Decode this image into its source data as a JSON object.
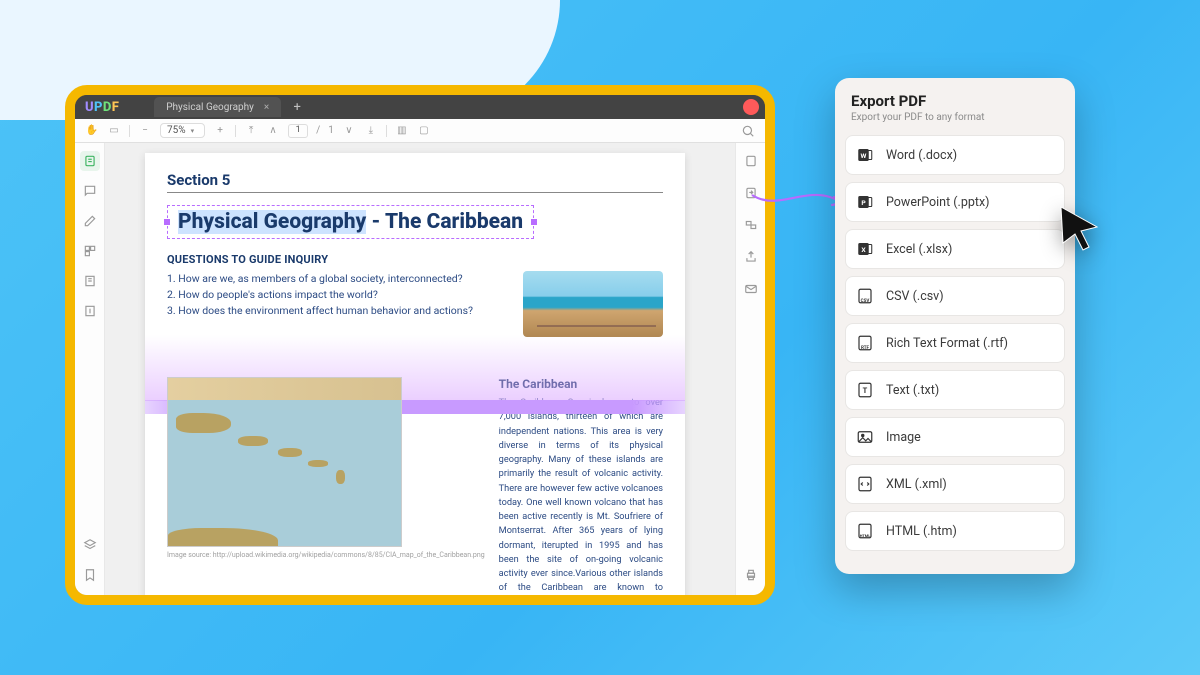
{
  "app": {
    "logo": "UPDF"
  },
  "tab": {
    "title": "Physical Geography"
  },
  "toolbar": {
    "zoom": "75%",
    "page_current": "1",
    "page_total": "1"
  },
  "doc": {
    "section_label": "Section 5",
    "title_highlight": "Physical Geography",
    "title_sep": " - ",
    "title_rest": "The Caribbean",
    "inquiry_header": "QUESTIONS TO GUIDE INQUIRY",
    "q1": "1. How are we, as members of a global society, interconnected?",
    "q2": "2. How do people's actions impact the world?",
    "q3": "3. How does the environment affect human behavior and actions?",
    "body_header": "The Caribbean",
    "body_text": "The Caribbean Sea is home to over 7,000 islands, thirteen of which are independent nations. This area is very diverse in terms of its physical geography. Many of these islands are primarily the result of volcanic activity. There are however few active volcanoes today. One well known volcano that has been active recently is Mt. Soufriere of Montserrat. After 365 years of lying dormant, iterupted in 1995 and has been the site of on-going volcanic activity ever since.Various other islands of the Caribbean are known to experience various forms of volcanic activity, even the island of Trinidad has small volcanoes. Most of the non-volcanic island found in this area are coral islands that formed from the coral reefs found throughout the Caribbean.",
    "map_caption": "Image source: http://upload.wikimedia.org/wikipedia/commons/8/85/CIA_map_of_the_Caribbean.png"
  },
  "export": {
    "title": "Export PDF",
    "subtitle": "Export your PDF to any format",
    "formats": {
      "word": "Word (.docx)",
      "ppt": "PowerPoint (.pptx)",
      "excel": "Excel (.xlsx)",
      "csv": "CSV (.csv)",
      "rtf": "Rich Text Format (.rtf)",
      "txt": "Text (.txt)",
      "image": "Image",
      "xml": "XML (.xml)",
      "html": "HTML (.htm)"
    }
  }
}
